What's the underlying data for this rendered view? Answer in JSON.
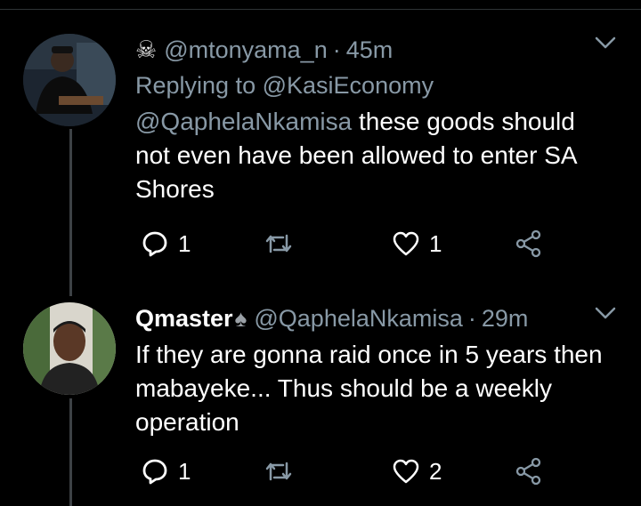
{
  "tweets": [
    {
      "display_name": "",
      "name_emoji": "☠",
      "handle": "@mtonyama_n",
      "time": "45m",
      "replying_to_prefix": "Replying to",
      "replying_to_handle": "@KasiEconomy",
      "mention": "@QaphelaNkamisa",
      "text": " these goods should not even have been allowed to enter SA Shores",
      "reply_count": "1",
      "retweet_count": "",
      "like_count": "1"
    },
    {
      "display_name": "Qmaster",
      "name_emoji": "♠",
      "handle": "@QaphelaNkamisa",
      "time": "29m",
      "text": "If they are gonna raid once in 5 years then mabayeke... Thus should be a weekly operation",
      "reply_count": "1",
      "retweet_count": "",
      "like_count": "2"
    }
  ],
  "icons": {
    "reply": "reply-icon",
    "retweet": "retweet-icon",
    "like": "heart-icon",
    "share": "share-icon",
    "more": "chevron-down-icon"
  },
  "colors": {
    "background": "#000000",
    "muted": "#8899a6",
    "text": "#ffffff"
  }
}
